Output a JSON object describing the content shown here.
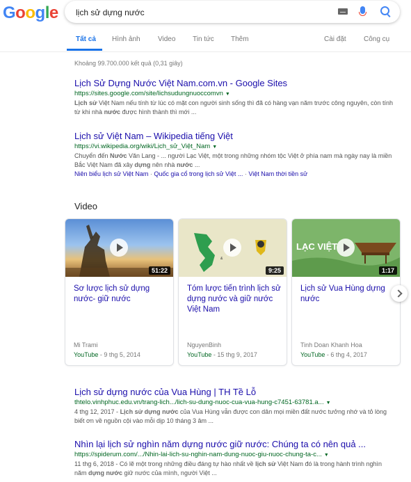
{
  "header": {
    "logo_letters": [
      "G",
      "o",
      "o",
      "g",
      "l",
      "e"
    ],
    "search_value": "lịch sử dựng nước",
    "icons": [
      "keyboard-icon",
      "mic-icon",
      "search-icon"
    ]
  },
  "tabs": {
    "all": "Tất cả",
    "images": "Hình ảnh",
    "video": "Video",
    "news": "Tin tức",
    "more": "Thêm",
    "settings": "Cài đặt",
    "tools": "Công cụ"
  },
  "stats": "Khoảng 99.700.000 kết quả (0,31 giây)",
  "results": [
    {
      "title": "Lịch Sử Dựng Nước Việt Nam.com.vn - Google Sites",
      "url": "https://sites.google.com/site/lichsudungnuoccomvn",
      "snippet_html": "<b>Lịch sử</b> Việt Nam nếu tính từ lúc có mặt con người sinh sống thì đã có hàng vạn năm trước công nguyên, còn tính từ khi nhà <b>nước</b> được hình thành thì mới ..."
    },
    {
      "title": "Lịch sử Việt Nam – Wikipedia tiếng Việt",
      "url": "https://vi.wikipedia.org/wiki/Lịch_sử_Việt_Nam",
      "snippet_html": "Chuyển đến <b>Nước</b> Văn Lang - ... người Lạc Việt, một trong những nhóm tộc Việt ở phía nam mà ngày nay là miền Bắc Việt Nam đã xây <b>dựng</b> nên nhà <b>nước</b> ...",
      "sitelinks": [
        "Niên biểu lịch sử Việt Nam",
        "Quốc gia cổ trong lịch sử Việt ...",
        "Việt Nam thời tiền sử"
      ]
    },
    {
      "title": "Lịch sử dựng nước của Vua Hùng | TH Tề Lỗ",
      "url": "thtelo.vinhphuc.edu.vn/trang-lich.../lich-su-dung-nuoc-cua-vua-hung-c7451-63781.a...",
      "snippet_html": "4 thg 12, 2017 - <b>Lịch sử dựng nước</b> của Vua Hùng vẫn được con dân mọi miền đất nước tưởng nhớ và tỏ lòng biết ơn về nguồn cội vào mỗi dịp 10 tháng 3 âm ..."
    },
    {
      "title": "Nhìn lại lịch sử nghìn năm dựng nước giữ nước: Chúng ta có nên quả ...",
      "url": "https://spiderum.com/.../Nhin-lai-lich-su-nghin-nam-dung-nuoc-giu-nuoc-chung-ta-c...",
      "snippet_html": "11 thg 6, 2018 - Có lẽ một trong những điều đáng tự hào nhất về <b>lịch sử</b> Việt Nam đó là trong hành trình nghìn năm <b>dựng nước</b> giữ nước của mình, người Việt ..."
    }
  ],
  "videos": {
    "heading": "Video",
    "items": [
      {
        "title": "Sơ lược lịch sử dựng nước- giữ nước",
        "duration": "51:22",
        "channel": "Mi Trami",
        "source": "YouTube",
        "date": "9 thg 5, 2014"
      },
      {
        "title": "Tóm lược tiến trình lịch sử dựng nước và giữ nước Việt Nam",
        "duration": "9:25",
        "channel": "NguyenBinh",
        "source": "YouTube",
        "date": "15 thg 9, 2017"
      },
      {
        "title": "Lịch sử Vua Hùng dựng nước",
        "duration": "1:17",
        "channel": "Tinh Doan Khanh Hoa",
        "source": "YouTube",
        "date": "6 thg 4, 2017",
        "thumb_text": "LẠC VIỆT"
      }
    ]
  },
  "colors": {
    "link": "#1a0dab",
    "url_green": "#006621",
    "accent_blue": "#1a73e8"
  }
}
